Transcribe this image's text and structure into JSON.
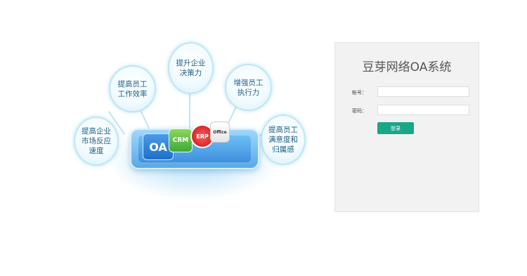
{
  "illustration": {
    "bubbles": [
      {
        "text": "提高企业\n市场反应\n速度"
      },
      {
        "text": "提高员工\n工作效率"
      },
      {
        "text": "提升企业\n决策力"
      },
      {
        "text": "增强员工\n执行力"
      },
      {
        "text": "提高员工\n满意度和\n归属感"
      }
    ],
    "apps": {
      "oa": "OA",
      "crm": "CRM",
      "erp": "ERP",
      "office": "Office"
    }
  },
  "login": {
    "title": "豆芽网络OA系统",
    "username_label": "帐号：",
    "username_value": "",
    "password_label": "密码：",
    "password_value": "",
    "submit_label": "登录",
    "colors": {
      "button": "#1aa688",
      "panel": "#f2f2f2"
    }
  }
}
